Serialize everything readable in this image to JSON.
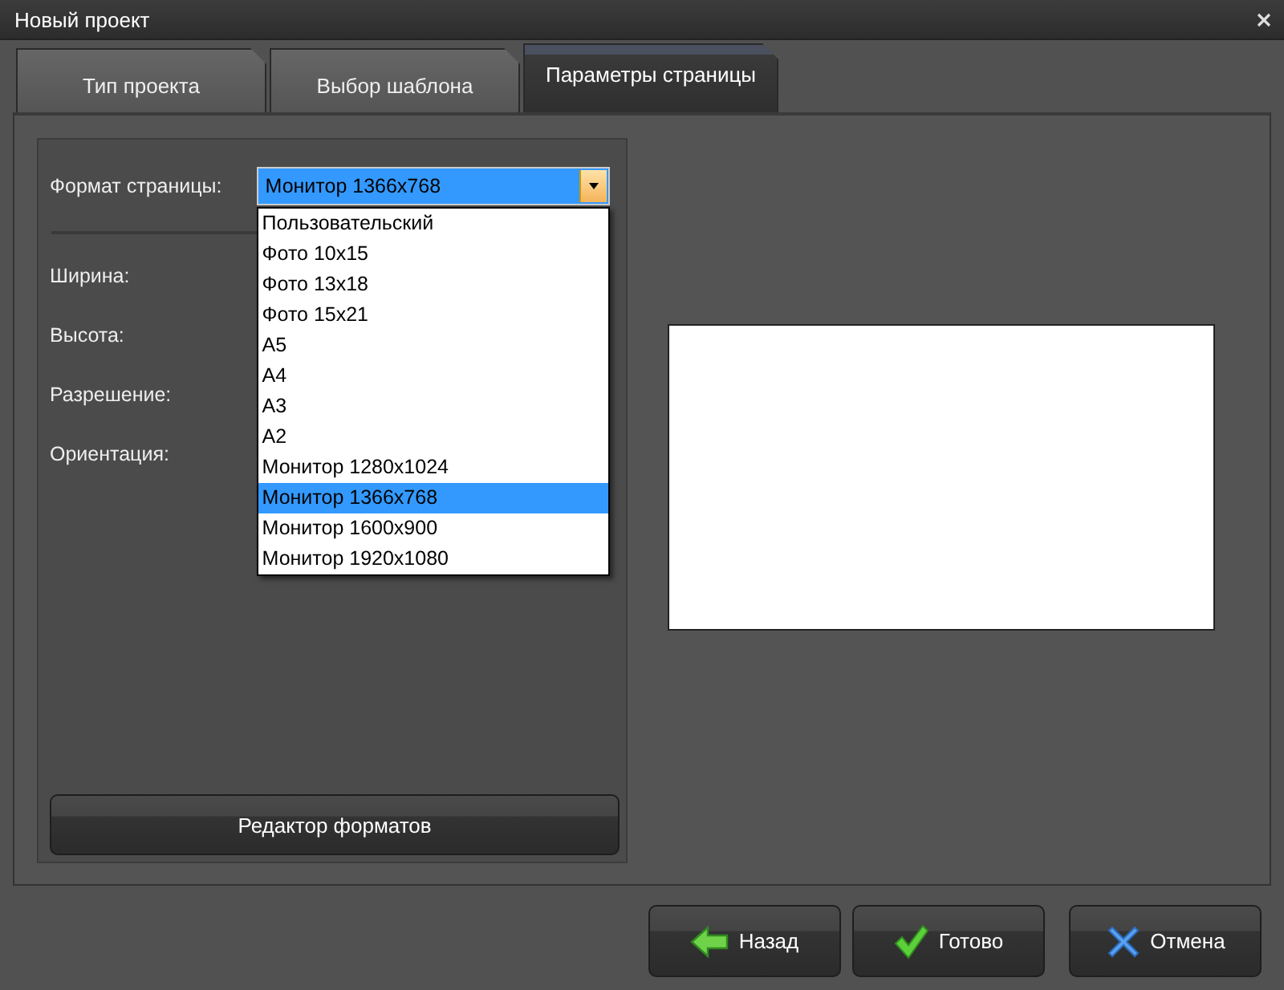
{
  "window": {
    "title": "Новый проект"
  },
  "tabs": [
    {
      "label": "Тип проекта",
      "selected": false
    },
    {
      "label": "Выбор шаблона",
      "selected": false
    },
    {
      "label": "Параметры страницы",
      "selected": true
    }
  ],
  "page_format": {
    "label": "Формат страницы:",
    "value": "Монитор 1366x768",
    "expanded": true,
    "options": [
      {
        "label": "Пользовательский",
        "selected": false
      },
      {
        "label": "Фото 10x15",
        "selected": false
      },
      {
        "label": "Фото 13x18",
        "selected": false
      },
      {
        "label": "Фото 15x21",
        "selected": false
      },
      {
        "label": "A5",
        "selected": false
      },
      {
        "label": "A4",
        "selected": false
      },
      {
        "label": "A3",
        "selected": false
      },
      {
        "label": "A2",
        "selected": false
      },
      {
        "label": "Монитор 1280x1024",
        "selected": false
      },
      {
        "label": "Монитор 1366x768",
        "selected": true
      },
      {
        "label": "Монитор 1600x900",
        "selected": false
      },
      {
        "label": "Монитор 1920x1080",
        "selected": false
      }
    ]
  },
  "fields": [
    {
      "label": "Ширина:"
    },
    {
      "label": "Высота:"
    },
    {
      "label": "Разрешение:"
    },
    {
      "label": "Ориентация:"
    }
  ],
  "format_editor_button": "Редактор форматов",
  "buttons": [
    {
      "label": "Назад",
      "kind": "back"
    },
    {
      "label": "Готово",
      "kind": "done"
    },
    {
      "label": "Отмена",
      "kind": "cancel"
    }
  ]
}
